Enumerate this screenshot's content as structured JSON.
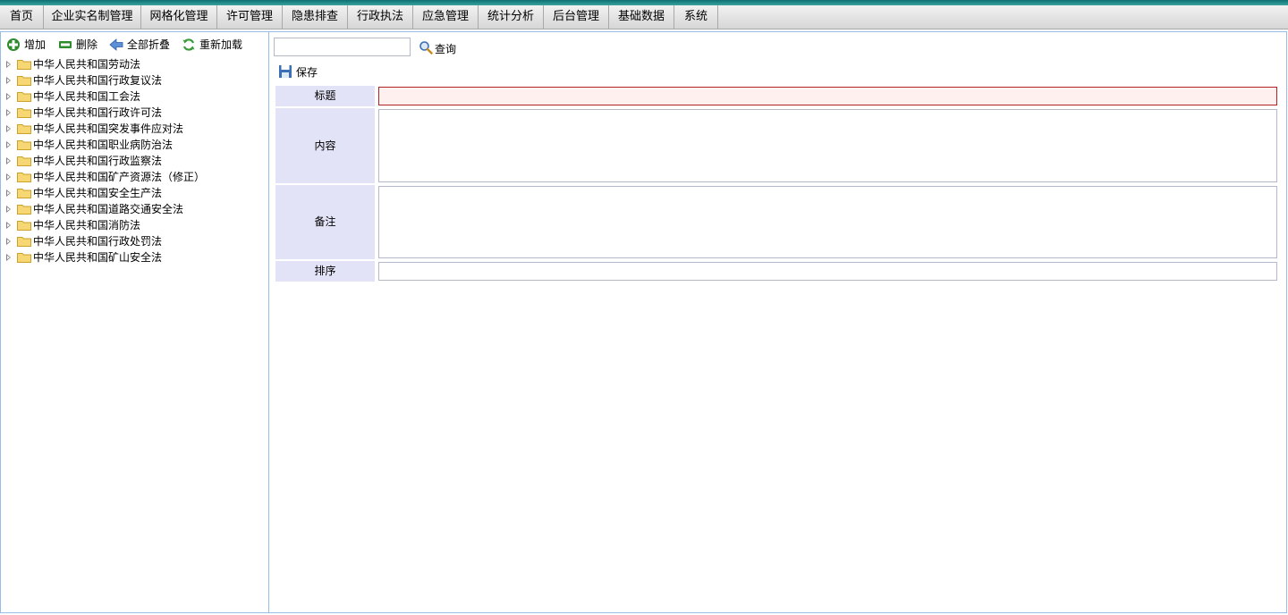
{
  "menu": {
    "items": [
      "首页",
      "企业实名制管理",
      "网格化管理",
      "许可管理",
      "隐患排查",
      "行政执法",
      "应急管理",
      "统计分析",
      "后台管理",
      "基础数据",
      "系统"
    ]
  },
  "tree_toolbar": {
    "add_label": "增加",
    "delete_label": "删除",
    "collapse_label": "全部折叠",
    "reload_label": "重新加载"
  },
  "tree": {
    "nodes": [
      "中华人民共和国劳动法",
      "中华人民共和国行政复议法",
      "中华人民共和国工会法",
      "中华人民共和国行政许可法",
      "中华人民共和国突发事件应对法",
      "中华人民共和国职业病防治法",
      "中华人民共和国行政监察法",
      "中华人民共和国矿产资源法（修正）",
      "中华人民共和国安全生产法",
      "中华人民共和国道路交通安全法",
      "中华人民共和国消防法",
      "中华人民共和国行政处罚法",
      "中华人民共和国矿山安全法"
    ]
  },
  "search": {
    "value": "",
    "button_label": "查询"
  },
  "form": {
    "save_label": "保存",
    "title_label": "标题",
    "title_value": "",
    "content_label": "内容",
    "content_value": "",
    "remark_label": "备注",
    "remark_value": "",
    "order_label": "排序",
    "order_value": ""
  },
  "colors": {
    "top_strip": "#0e6f73",
    "panel_border": "#99bbe8",
    "label_bg": "#e3e3f7",
    "invalid_border": "#b22222"
  }
}
